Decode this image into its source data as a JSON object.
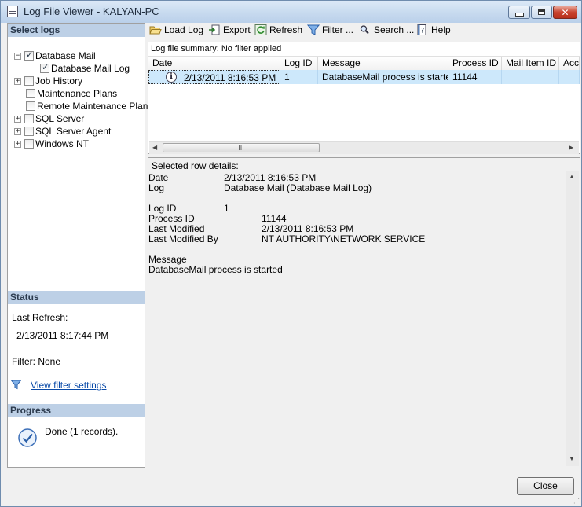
{
  "window": {
    "title": "Log File Viewer - KALYAN-PC"
  },
  "left": {
    "select_logs_header": "Select logs",
    "tree": [
      {
        "label": "Database Mail",
        "expander": "−",
        "checked": true
      },
      {
        "label": "Database Mail Log",
        "expander": "",
        "checked": true
      },
      {
        "label": "Job History",
        "expander": "+",
        "checked": false
      },
      {
        "label": "Maintenance Plans",
        "expander": "",
        "checked": false
      },
      {
        "label": "Remote Maintenance Plans",
        "expander": "",
        "checked": false
      },
      {
        "label": "SQL Server",
        "expander": "+",
        "checked": false
      },
      {
        "label": "SQL Server Agent",
        "expander": "+",
        "checked": false
      },
      {
        "label": "Windows NT",
        "expander": "+",
        "checked": false
      }
    ],
    "status": {
      "header": "Status",
      "last_refresh_label": "Last Refresh:",
      "last_refresh_value": "2/13/2011 8:17:44 PM",
      "filter": "Filter: None",
      "view_filter_link": "View filter settings"
    },
    "progress": {
      "header": "Progress",
      "text": "Done (1 records)."
    }
  },
  "toolbar": {
    "load_log": "Load Log",
    "export": "Export",
    "refresh": "Refresh",
    "filter": "Filter ...",
    "search": "Search ...",
    "help": "Help"
  },
  "grid": {
    "summary": "Log file summary: No filter applied",
    "columns": [
      "Date",
      "Log ID",
      "Message",
      "Process ID",
      "Mail Item ID",
      "Acc"
    ],
    "rows": [
      {
        "date": "2/13/2011 8:16:53 PM",
        "log_id": "1",
        "message": "DatabaseMail process is started",
        "process_id": "11144",
        "mail_item_id": "",
        "acc": ""
      }
    ],
    "scroll_grip": "III"
  },
  "details": {
    "header": "Selected row details:",
    "date_label": "Date",
    "date_value": "2/13/2011 8:16:53 PM",
    "log_label": "Log",
    "log_value": "Database Mail (Database Mail Log)",
    "log_id_label": "Log ID",
    "log_id_value": "1",
    "process_id_label": "Process ID",
    "process_id_value": "11144",
    "last_modified_label": "Last Modified",
    "last_modified_value": "2/13/2011 8:16:53 PM",
    "last_modified_by_label": "Last Modified By",
    "last_modified_by_value": "NT AUTHORITY\\NETWORK SERVICE",
    "message_label": "Message",
    "message_value": "DatabaseMail process is started"
  },
  "buttons": {
    "close": "Close"
  },
  "icons": {
    "app": "log-viewer-icon",
    "load_log": "folder-open-icon",
    "export": "export-icon",
    "refresh": "refresh-icon",
    "filter": "filter-funnel-icon",
    "search": "magnifier-icon",
    "help": "help-book-icon",
    "info": "info-icon",
    "progress_done": "checkmark-circle-icon"
  },
  "colors": {
    "section_header": "#bdd0e6",
    "selected_row": "#cde8fb",
    "link": "#0b4ba8",
    "close_button_chrome": "#c9442f"
  }
}
